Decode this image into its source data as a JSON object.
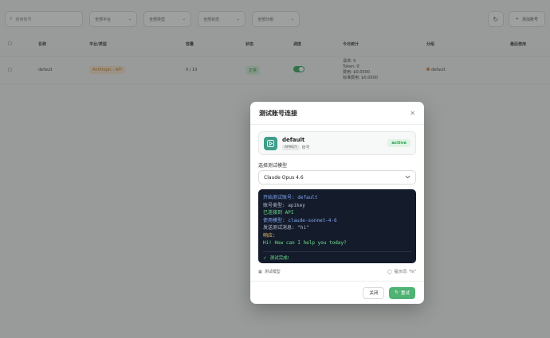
{
  "background": {
    "toolbar": {
      "search_placeholder": "搜索账号",
      "filters": [
        "全部平台",
        "全部类型",
        "全部状态",
        "全部分组"
      ],
      "create_label": "添加账号"
    },
    "table": {
      "headers": [
        "名称",
        "平台/类型",
        "容量",
        "状态",
        "调度",
        "今日统计",
        "分组",
        "最后使用"
      ],
      "row": {
        "name": "default",
        "platform": "Anthropic · API",
        "capacity": "0 / 10",
        "status": "正常",
        "stats": [
          "请求: 0",
          "Token: 0",
          "费用: $0.0000",
          "标准费用: $0.0000"
        ],
        "group": "default"
      }
    }
  },
  "modal": {
    "title": "测试账号连接",
    "close_icon": "close-icon",
    "account": {
      "name": "default",
      "type_badge": "APIKEY",
      "type_label": "账号",
      "status": "active"
    },
    "model_section_label": "选择测试模型",
    "selected_model": "Claude Opus 4.6",
    "console": {
      "lines": [
        {
          "text": "开始测试账号: default",
          "color": "blue"
        },
        {
          "text": "账号类型: apikey",
          "color": "gray"
        },
        {
          "text": "已连接到 API",
          "color": "green"
        },
        {
          "text": "使用模型: claude-sonnet-4-6",
          "color": "blue"
        },
        {
          "text": "发送测试消息: \"hi\"",
          "color": "gray"
        },
        {
          "text": "响应:",
          "color": "yellow"
        },
        {
          "text": "Hi! How can I help you today?",
          "color": "green"
        }
      ],
      "done_text": "测试完成!"
    },
    "meta": {
      "left_label": "测试模型",
      "right_label": "提示词: \"hi\""
    },
    "footer": {
      "close_label": "关闭",
      "retry_label": "重试"
    }
  },
  "colors": {
    "accent": "#4fb374",
    "console_bg": "#141b2b"
  }
}
